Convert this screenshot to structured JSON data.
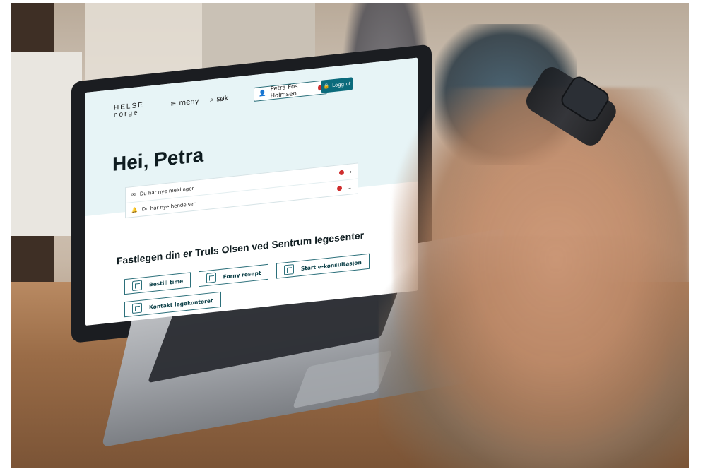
{
  "site": {
    "logo_line1": "HELSE",
    "logo_line2": "norge",
    "nav_menu": "meny",
    "nav_search": "søk",
    "user_name": "Petra Fos Holmsen",
    "logout": "Logg ut"
  },
  "hero": {
    "greeting": "Hei, Petra"
  },
  "notifications": [
    {
      "label": "Du har nye meldinger"
    },
    {
      "label": "Du har nye hendelser"
    }
  ],
  "gp": {
    "title": "Fastlegen din er Truls Olsen ved Sentrum legesenter",
    "actions": [
      {
        "label": "Bestill time",
        "icon": "calendar-icon"
      },
      {
        "label": "Forny resept",
        "icon": "prescription-icon"
      },
      {
        "label": "Start e-konsultasjon",
        "icon": "consultation-icon"
      },
      {
        "label": "Kontakt legekontoret",
        "icon": "contact-icon"
      }
    ]
  },
  "colors": {
    "accent": "#0b6b7c",
    "notification_red": "#cf2e2e",
    "header_bg": "#e7f4f6"
  }
}
